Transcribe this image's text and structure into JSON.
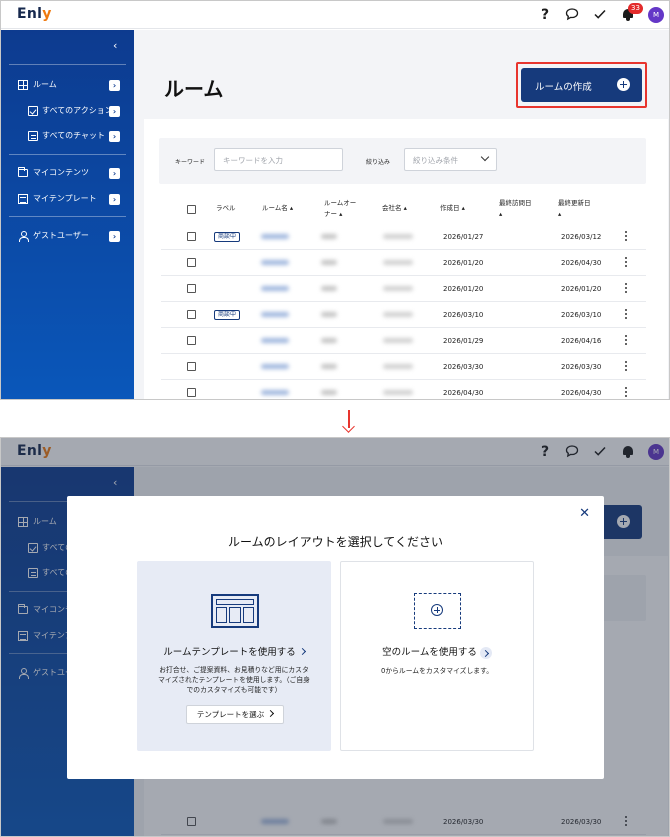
{
  "app": {
    "logo_text": "Enl",
    "logo_accent": "y",
    "notification_count": "33",
    "avatar_initial": "M"
  },
  "sidebar": {
    "items": [
      {
        "label": "ルーム",
        "icon": "grid-icon"
      },
      {
        "label": "すべてのアクション",
        "icon": "checkbox-icon"
      },
      {
        "label": "すべてのチャット",
        "icon": "chat-icon"
      },
      {
        "label": "マイコンテンツ",
        "icon": "folder-icon"
      },
      {
        "label": "マイテンプレート",
        "icon": "template-icon"
      },
      {
        "label": "ゲストユーザー",
        "icon": "user-icon"
      }
    ],
    "trunc": [
      "すべての",
      "すべての",
      "マイコンテ",
      "マイテンプ",
      "ゲストユー"
    ]
  },
  "main": {
    "title": "ルーム",
    "create_button": "ルームの作成",
    "filter": {
      "keyword_label": "キーワード",
      "keyword_placeholder": "キーワードを入力",
      "filter_label": "絞り込み",
      "filter_placeholder": "絞り込み条件"
    },
    "columns": {
      "label": "ラベル",
      "room": "ルーム名",
      "owner1": "ルームオー",
      "owner2": "ナー",
      "company": "会社名",
      "created": "作成日",
      "visited1": "最終訪問日",
      "updated1": "最終更新日"
    },
    "rows": [
      {
        "tag": "商談中",
        "created": "2026/01/27",
        "updated": "2026/03/12"
      },
      {
        "tag": "",
        "created": "2026/01/20",
        "updated": "2026/04/30"
      },
      {
        "tag": "",
        "created": "2026/01/20",
        "updated": "2026/01/20"
      },
      {
        "tag": "商談中",
        "created": "2026/03/10",
        "updated": "2026/03/10"
      },
      {
        "tag": "",
        "created": "2026/01/29",
        "updated": "2026/04/16"
      },
      {
        "tag": "",
        "created": "2026/03/30",
        "updated": "2026/03/30"
      },
      {
        "tag": "",
        "created": "2026/04/30",
        "updated": "2026/04/30"
      }
    ],
    "bg_rows": [
      {
        "created": "2026/03/30",
        "updated": "2026/03/30"
      },
      {
        "created": "2026/04/30",
        "updated": "2026/04/30"
      }
    ]
  },
  "modal": {
    "title": "ルームのレイアウトを選択してください",
    "template_option": {
      "title": "ルームテンプレートを使用する",
      "desc": "お打合せ、ご提案資料、お見積りなど用にカスタマイズされたテンプレートを使用します。（ご自身でのカスタマイズも可能です）",
      "button": "テンプレートを選ぶ"
    },
    "empty_option": {
      "title": "空のルームを使用する",
      "desc": "0からルームをカスタマイズします。"
    }
  },
  "colors": {
    "sidebar": "#0d3b8f",
    "primary": "#163a7c",
    "highlight": "#e8352e",
    "badge": "#e32b2b",
    "avatar": "#6437c7"
  }
}
